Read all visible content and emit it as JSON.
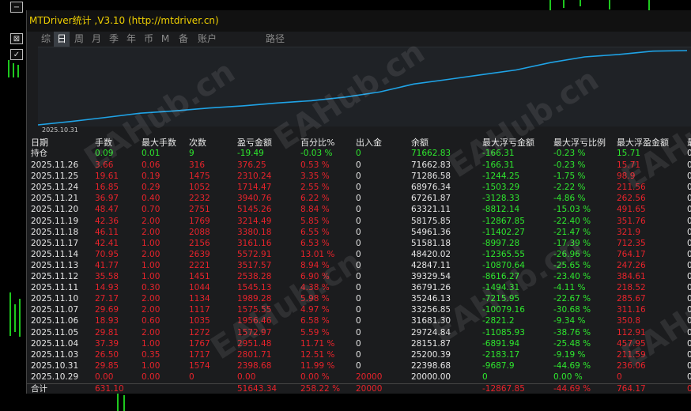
{
  "window": {
    "title": "MTDriver统计 ,V3.10 (http://mtdriver.cn)"
  },
  "tabs": [
    {
      "label": "综",
      "active": false
    },
    {
      "label": "日",
      "active": true
    },
    {
      "label": "周",
      "active": false
    },
    {
      "label": "月",
      "active": false
    },
    {
      "label": "季",
      "active": false
    },
    {
      "label": "年",
      "active": false
    },
    {
      "label": "币",
      "active": false
    },
    {
      "label": "M",
      "active": false
    },
    {
      "label": "备",
      "active": false
    },
    {
      "label": "账户",
      "active": false
    },
    {
      "label": "路径",
      "active": false
    }
  ],
  "chart_data": {
    "type": "line",
    "x_start_label": "2025.10.31",
    "x": [
      "2025.10.29",
      "2025.10.31",
      "2025.11.03",
      "2025.11.04",
      "2025.11.05",
      "2025.11.06",
      "2025.11.07",
      "2025.11.10",
      "2025.11.11",
      "2025.11.12",
      "2025.11.13",
      "2025.11.14",
      "2025.11.17",
      "2025.11.18",
      "2025.11.19",
      "2025.11.20",
      "2025.11.21",
      "2025.11.24",
      "2025.11.25",
      "2025.11.26"
    ],
    "series": [
      {
        "values": [
          20000,
          22398.68,
          25200.39,
          28151.87,
          29724.84,
          31681.3,
          33256.85,
          35246.13,
          36791.26,
          39329.54,
          42847.11,
          48420.02,
          51581.18,
          54961.36,
          58175.85,
          63321.11,
          67261.87,
          68976.34,
          71286.58,
          71662.83
        ],
        "color": "#1fa3e6"
      }
    ]
  },
  "table": {
    "headers": [
      "日期",
      "手数",
      "最大手数",
      "次数",
      "盈亏金额",
      "百分比%",
      "出入金",
      "余额",
      "最大浮亏金额",
      "最大浮亏比例",
      "最大浮盈金额",
      "最"
    ],
    "position_row": [
      "持仓",
      "0.09",
      "0.01",
      "9",
      "-19.49",
      "-0.03 %",
      "0",
      "71662.83",
      "-166.31",
      "-0.23 %",
      "15.71",
      "0"
    ],
    "rows": [
      [
        "2025.11.26",
        "3.66",
        "0.06",
        "316",
        "376.25",
        "0.53 %",
        "0",
        "71662.83",
        "-166.31",
        "-0.23 %",
        "15.71",
        "0"
      ],
      [
        "2025.11.25",
        "19.61",
        "0.19",
        "1475",
        "2310.24",
        "3.35 %",
        "0",
        "71286.58",
        "-1244.25",
        "-1.75 %",
        "98.9",
        "0"
      ],
      [
        "2025.11.24",
        "16.85",
        "0.29",
        "1052",
        "1714.47",
        "2.55 %",
        "0",
        "68976.34",
        "-1503.29",
        "-2.22 %",
        "211.56",
        "0"
      ],
      [
        "2025.11.21",
        "36.97",
        "0.40",
        "2232",
        "3940.76",
        "6.22 %",
        "0",
        "67261.87",
        "-3128.33",
        "-4.86 %",
        "262.56",
        "0"
      ],
      [
        "2025.11.20",
        "48.47",
        "0.70",
        "2751",
        "5145.26",
        "8.84 %",
        "0",
        "63321.11",
        "-8812.14",
        "-15.03 %",
        "491.65",
        "0"
      ],
      [
        "2025.11.19",
        "42.36",
        "2.00",
        "1769",
        "3214.49",
        "5.85 %",
        "0",
        "58175.85",
        "-12867.85",
        "-22.40 %",
        "351.76",
        "0"
      ],
      [
        "2025.11.18",
        "46.11",
        "2.00",
        "2088",
        "3380.18",
        "6.55 %",
        "0",
        "54961.36",
        "-11402.27",
        "-21.47 %",
        "321.9",
        "0"
      ],
      [
        "2025.11.17",
        "42.41",
        "1.00",
        "2156",
        "3161.16",
        "6.53 %",
        "0",
        "51581.18",
        "-8997.28",
        "-17.39 %",
        "712.35",
        "0"
      ],
      [
        "2025.11.14",
        "70.95",
        "2.00",
        "2639",
        "5572.91",
        "13.01 %",
        "0",
        "48420.02",
        "-12365.55",
        "-26.96 %",
        "764.17",
        "0"
      ],
      [
        "2025.11.13",
        "41.77",
        "1.00",
        "2221",
        "3517.57",
        "8.94 %",
        "0",
        "42847.11",
        "-10870.64",
        "-25.65 %",
        "247.26",
        "0"
      ],
      [
        "2025.11.12",
        "35.58",
        "1.00",
        "1451",
        "2538.28",
        "6.90 %",
        "0",
        "39329.54",
        "-8616.27",
        "-23.40 %",
        "384.61",
        "0"
      ],
      [
        "2025.11.11",
        "14.93",
        "0.30",
        "1044",
        "1545.13",
        "4.38 %",
        "0",
        "36791.26",
        "-1494.31",
        "-4.11 %",
        "218.52",
        "0"
      ],
      [
        "2025.11.10",
        "27.17",
        "2.00",
        "1134",
        "1989.28",
        "5.98 %",
        "0",
        "35246.13",
        "-7215.95",
        "-22.67 %",
        "285.67",
        "0"
      ],
      [
        "2025.11.07",
        "29.69",
        "2.00",
        "1117",
        "1575.55",
        "4.97 %",
        "0",
        "33256.85",
        "-10079.16",
        "-30.68 %",
        "311.16",
        "0"
      ],
      [
        "2025.11.06",
        "18.93",
        "0.60",
        "1035",
        "1956.46",
        "6.58 %",
        "0",
        "31681.30",
        "-2821.2",
        "-9.34 %",
        "350.8",
        "0"
      ],
      [
        "2025.11.05",
        "29.81",
        "2.00",
        "1272",
        "1572.97",
        "5.59 %",
        "0",
        "29724.84",
        "-11085.93",
        "-38.76 %",
        "112.91",
        "0"
      ],
      [
        "2025.11.04",
        "37.39",
        "1.00",
        "1767",
        "2951.48",
        "11.71 %",
        "0",
        "28151.87",
        "-6891.94",
        "-25.48 %",
        "457.95",
        "0"
      ],
      [
        "2025.11.03",
        "26.50",
        "0.35",
        "1717",
        "2801.71",
        "12.51 %",
        "0",
        "25200.39",
        "-2183.17",
        "-9.19 %",
        "211.59",
        "0"
      ],
      [
        "2025.10.31",
        "29.85",
        "1.00",
        "1574",
        "2398.68",
        "11.99 %",
        "0",
        "22398.68",
        "-9687.9",
        "-44.69 %",
        "236.06",
        "0"
      ],
      [
        "2025.10.29",
        "0.00",
        "0.00",
        "0",
        "0.00",
        "0.00 %",
        "20000",
        "20000.00",
        "0",
        "0.00 %",
        "0",
        "0"
      ]
    ],
    "summary_row": [
      "合计",
      "631.10",
      "",
      "",
      "51643.34",
      "258.22 %",
      "20000",
      "",
      "-12867.85",
      "-44.69 %",
      "764.17",
      "0"
    ]
  },
  "colors": {
    "loss": "#e8232b",
    "profit": "#2ee82e",
    "title": "#f0d000",
    "curve": "#1fa3e6"
  },
  "watermark": "EAHub.cn"
}
